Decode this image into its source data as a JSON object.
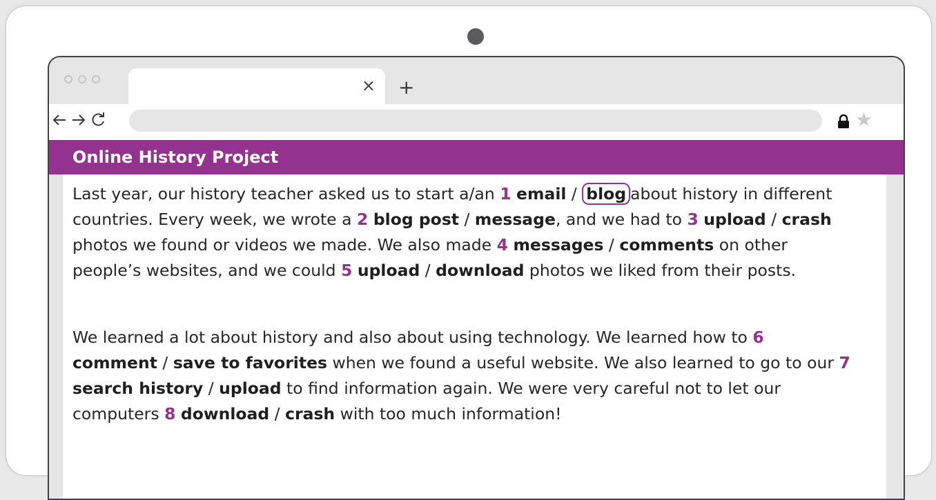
{
  "browser": {
    "tab_close": "×",
    "new_tab": "+",
    "nav_icons": {
      "back": "back-arrow-icon",
      "forward": "forward-arrow-icon",
      "refresh": "refresh-icon"
    },
    "lock_icon": "lock-icon",
    "star_icon": "star-icon"
  },
  "site": {
    "title": "Online History Project"
  },
  "paragraph1": {
    "t1": "Last year, our history teacher asked us to start a/an ",
    "n1": "1",
    "o1a": "email",
    "s1": " / ",
    "o1b": "blog",
    "t2": "about history in different countries. Every week, we wrote a ",
    "n2": "2",
    "o2a": "blog post",
    "s2": " / ",
    "o2b": "message",
    "t3": ", and we had to ",
    "n3": "3",
    "o3a": "upload",
    "s3": " / ",
    "o3b": "crash",
    "t4": " photos we found or videos we made. We also made ",
    "n4": "4",
    "o4a": "messages",
    "s4": " / ",
    "o4b": "comments",
    "t5": " on other people’s websites, and we could ",
    "n5": "5",
    "o5a": "upload",
    "s5": " / ",
    "o5b": "download",
    "t6": " photos we liked from their posts."
  },
  "paragraph2": {
    "t1": "We learned a lot about history and also about using technology. We learned how to ",
    "n6": "6",
    "o6a": "comment",
    "s6": " / ",
    "o6b": "save to favorites",
    "t2": " when we found a useful website. We also learned to go to our ",
    "n7": "7",
    "o7a": "search history",
    "s7": " / ",
    "o7b": "upload",
    "t3": " to find information again. We were very careful not to let our computers ",
    "n8": "8",
    "o8a": "download",
    "s8": " / ",
    "o8b": "crash",
    "t4": " with too much information!"
  },
  "colors": {
    "accent": "#93338f",
    "frame": "#414143",
    "chrome": "#e6e6e7"
  }
}
